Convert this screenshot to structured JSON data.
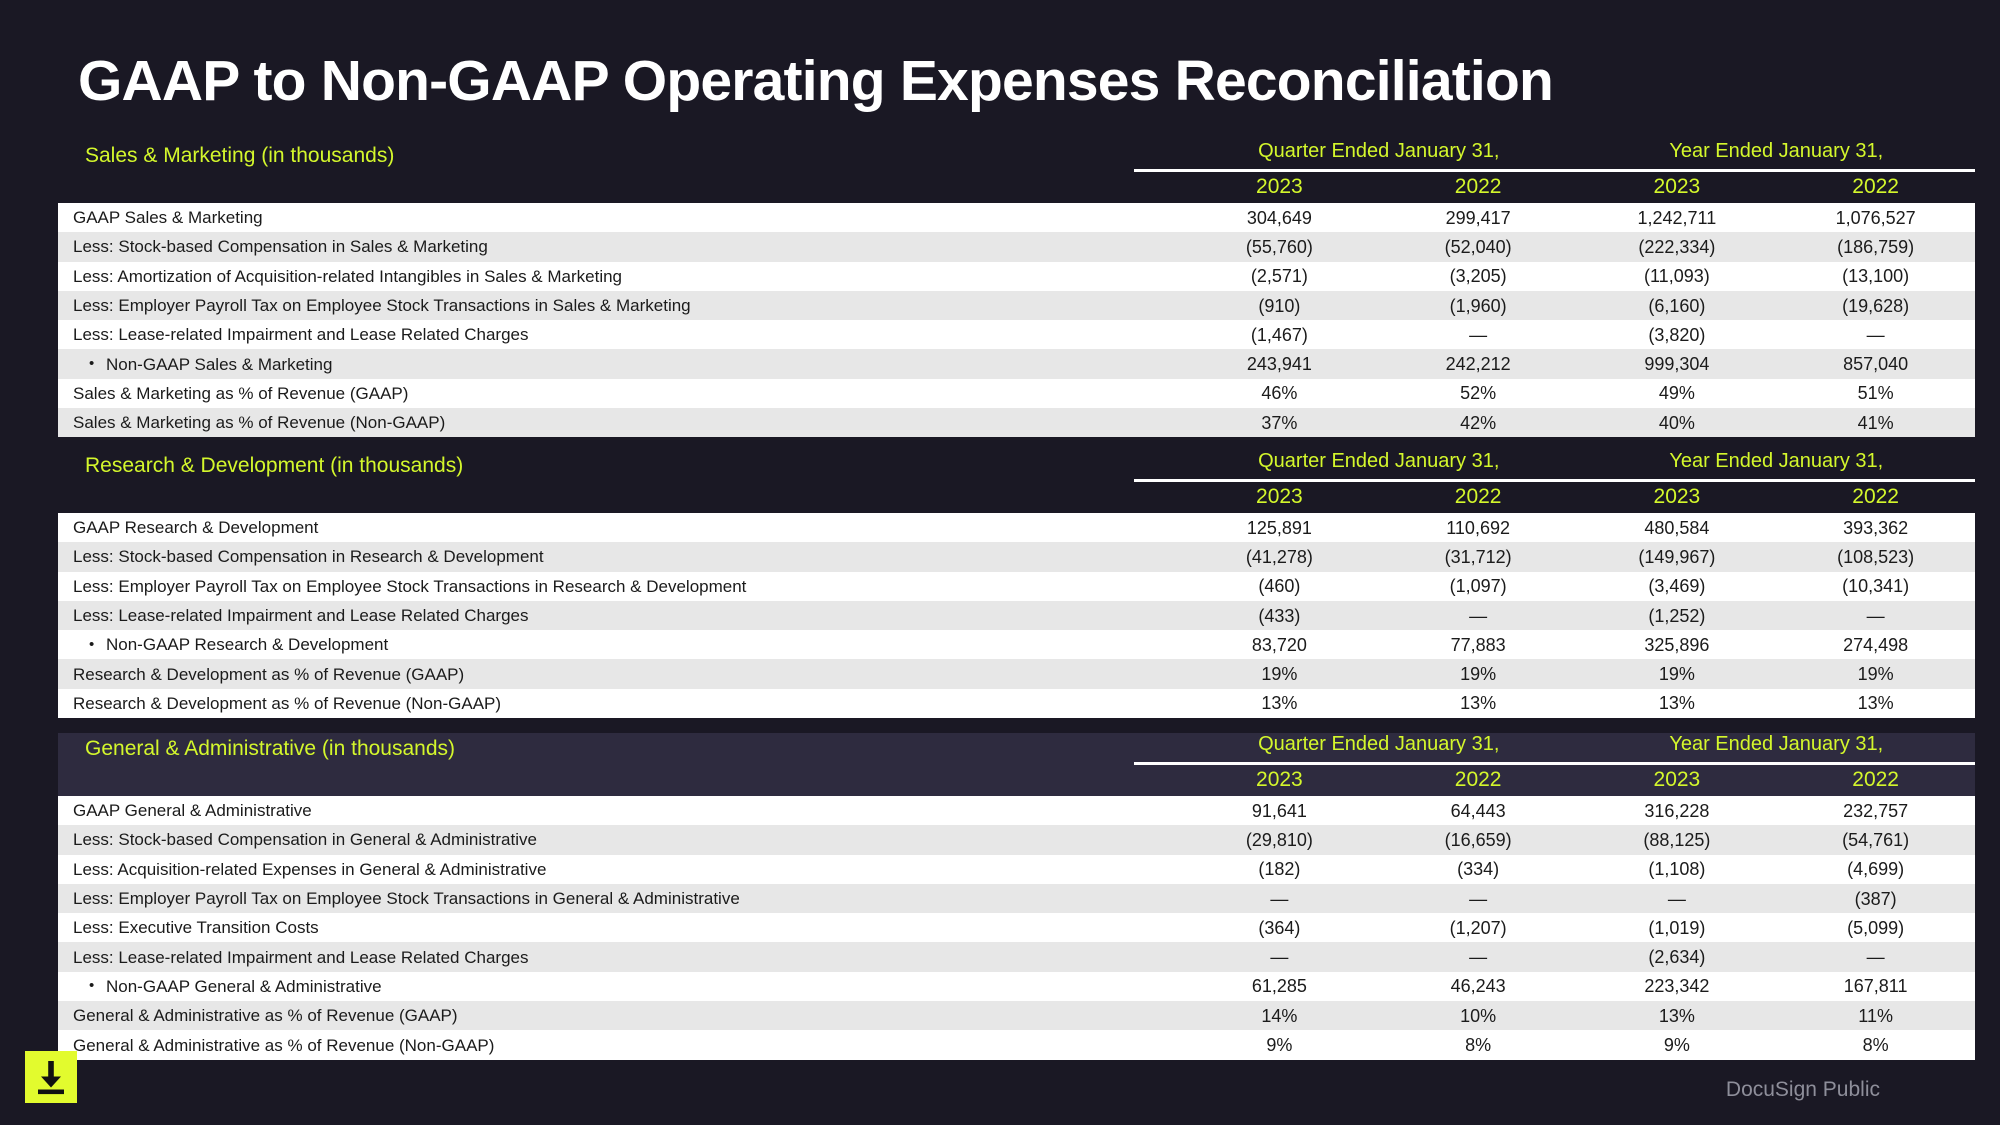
{
  "slide": {
    "title": "GAAP to Non-GAAP Operating Expenses Reconciliation",
    "footer_note": "DocuSign Public",
    "download_icon": "download-icon",
    "accent_color": "#d4f72c",
    "background_color": "#1a1824"
  },
  "column_groups": [
    {
      "label": "Quarter Ended January 31,",
      "years": [
        "2023",
        "2022"
      ]
    },
    {
      "label": "Year Ended January 31,",
      "years": [
        "2023",
        "2022"
      ]
    }
  ],
  "sections": [
    {
      "title": "Sales & Marketing (in thousands)",
      "rows": [
        {
          "label": "GAAP Sales & Marketing",
          "sub": false,
          "values": [
            "304,649",
            "299,417",
            "1,242,711",
            "1,076,527"
          ]
        },
        {
          "label": "Less: Stock-based Compensation in Sales & Marketing",
          "sub": false,
          "values": [
            "(55,760)",
            "(52,040)",
            "(222,334)",
            "(186,759)"
          ]
        },
        {
          "label": "Less: Amortization of Acquisition-related Intangibles in Sales & Marketing",
          "sub": false,
          "values": [
            "(2,571)",
            "(3,205)",
            "(11,093)",
            "(13,100)"
          ]
        },
        {
          "label": "Less: Employer Payroll Tax on Employee Stock Transactions in Sales & Marketing",
          "sub": false,
          "values": [
            "(910)",
            "(1,960)",
            "(6,160)",
            "(19,628)"
          ]
        },
        {
          "label": "Less: Lease-related Impairment and Lease Related Charges",
          "sub": false,
          "values": [
            "(1,467)",
            "—",
            "(3,820)",
            "—"
          ]
        },
        {
          "label": "Non-GAAP Sales & Marketing",
          "sub": true,
          "values": [
            "243,941",
            "242,212",
            "999,304",
            "857,040"
          ]
        },
        {
          "label": "Sales & Marketing as % of Revenue (GAAP)",
          "sub": false,
          "values": [
            "46%",
            "52%",
            "49%",
            "51%"
          ]
        },
        {
          "label": "Sales & Marketing as % of Revenue (Non-GAAP)",
          "sub": false,
          "values": [
            "37%",
            "42%",
            "40%",
            "41%"
          ]
        }
      ]
    },
    {
      "title": "Research & Development (in thousands)",
      "rows": [
        {
          "label": "GAAP Research & Development",
          "sub": false,
          "values": [
            "125,891",
            "110,692",
            "480,584",
            "393,362"
          ]
        },
        {
          "label": "Less: Stock-based Compensation in Research & Development",
          "sub": false,
          "values": [
            "(41,278)",
            "(31,712)",
            "(149,967)",
            "(108,523)"
          ]
        },
        {
          "label": "Less: Employer Payroll Tax on Employee Stock Transactions in Research & Development",
          "sub": false,
          "values": [
            "(460)",
            "(1,097)",
            "(3,469)",
            "(10,341)"
          ]
        },
        {
          "label": "Less: Lease-related Impairment and Lease Related Charges",
          "sub": false,
          "values": [
            "(433)",
            "—",
            "(1,252)",
            "—"
          ]
        },
        {
          "label": "Non-GAAP Research & Development",
          "sub": true,
          "values": [
            "83,720",
            "77,883",
            "325,896",
            "274,498"
          ]
        },
        {
          "label": "Research & Development as % of Revenue (GAAP)",
          "sub": false,
          "values": [
            "19%",
            "19%",
            "19%",
            "19%"
          ]
        },
        {
          "label": "Research & Development as % of Revenue (Non-GAAP)",
          "sub": false,
          "values": [
            "13%",
            "13%",
            "13%",
            "13%"
          ]
        }
      ]
    },
    {
      "title": "General & Administrative (in thousands)",
      "rows": [
        {
          "label": "GAAP General & Administrative",
          "sub": false,
          "values": [
            "91,641",
            "64,443",
            "316,228",
            "232,757"
          ]
        },
        {
          "label": "Less: Stock-based Compensation in General & Administrative",
          "sub": false,
          "values": [
            "(29,810)",
            "(16,659)",
            "(88,125)",
            "(54,761)"
          ]
        },
        {
          "label": "Less: Acquisition-related Expenses in General & Administrative",
          "sub": false,
          "values": [
            "(182)",
            "(334)",
            "(1,108)",
            "(4,699)"
          ]
        },
        {
          "label": "Less: Employer Payroll Tax on Employee Stock Transactions in General & Administrative",
          "sub": false,
          "values": [
            "—",
            "—",
            "—",
            "(387)"
          ]
        },
        {
          "label": "Less: Executive Transition Costs",
          "sub": false,
          "values": [
            "(364)",
            "(1,207)",
            "(1,019)",
            "(5,099)"
          ]
        },
        {
          "label": "Less:  Lease-related Impairment and Lease Related Charges",
          "sub": false,
          "values": [
            "—",
            "—",
            "(2,634)",
            "—"
          ]
        },
        {
          "label": "Non-GAAP General & Administrative",
          "sub": true,
          "values": [
            "61,285",
            "46,243",
            "223,342",
            "167,811"
          ]
        },
        {
          "label": "General & Administrative as % of Revenue (GAAP)",
          "sub": false,
          "values": [
            "14%",
            "10%",
            "13%",
            "11%"
          ]
        },
        {
          "label": "General & Administrative as % of Revenue (Non-GAAP)",
          "sub": false,
          "values": [
            "9%",
            "8%",
            "9%",
            "8%"
          ]
        }
      ]
    }
  ]
}
